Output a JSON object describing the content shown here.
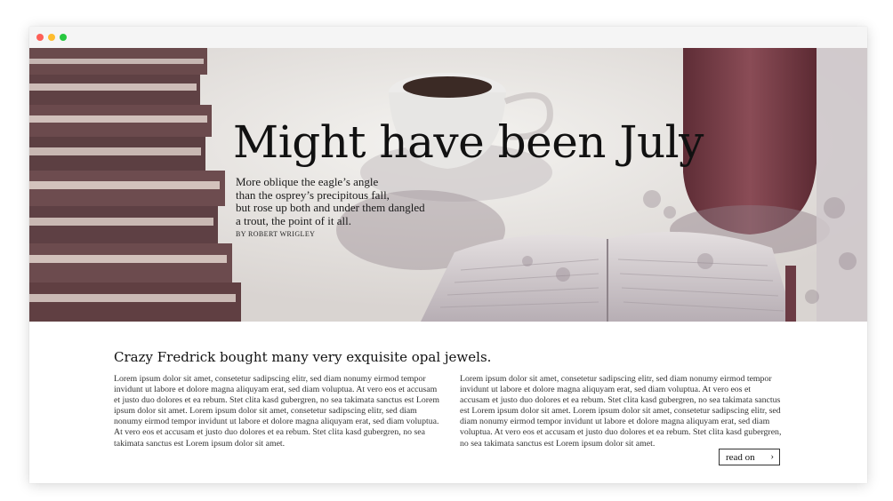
{
  "window": {
    "controls": [
      "close",
      "minimize",
      "zoom"
    ]
  },
  "hero": {
    "title": "Might have been July",
    "poem_lines": [
      "More oblique the eagle’s angle",
      "than the osprey’s precipitous fall,",
      "but rose up both and under them dangled",
      "a trout, the point of it all."
    ],
    "byline": "BY ROBERT WRIGLEY"
  },
  "article": {
    "headline": "Crazy Fredrick bought many very exquisite opal jewels.",
    "col_left": "Lorem ipsum dolor sit amet, consetetur sadipscing elitr, sed diam nonumy eirmod tempor invidunt ut labore et dolore magna aliquyam erat, sed diam voluptua. At vero eos et accusam et justo duo dolores et ea rebum. Stet clita kasd gubergren, no sea takimata sanctus est Lorem ipsum dolor sit amet. Lorem ipsum dolor sit amet, consetetur sadipscing elitr, sed diam nonumy eirmod tempor invidunt ut labore et dolore magna aliquyam erat, sed diam voluptua. At vero eos et accusam et justo duo dolores et ea rebum. Stet clita kasd gubergren, no sea takimata sanctus est Lorem ipsum dolor sit amet.",
    "col_right": "Lorem ipsum dolor sit amet, consetetur sadipscing elitr, sed diam nonumy eirmod tempor invidunt ut labore et dolore magna aliquyam erat, sed diam voluptua. At vero eos et accusam et justo duo dolores et ea rebum. Stet clita kasd gubergren, no sea takimata sanctus est Lorem ipsum dolor sit amet. Lorem ipsum dolor sit amet, consetetur sadipscing elitr, sed diam nonumy eirmod tempor invidunt ut labore et dolore magna aliquyam erat, sed diam voluptua. At vero eos et accusam et justo duo dolores et ea rebum. Stet clita kasd gubergren, no sea takimata sanctus est Lorem ipsum dolor sit amet.",
    "read_on_label": "read on",
    "read_on_icon": "chevron-right-icon"
  },
  "colors": {
    "window_close": "#fe5f57",
    "window_minimize": "#febc2e",
    "window_zoom": "#28c840",
    "text_dark": "#111111"
  }
}
